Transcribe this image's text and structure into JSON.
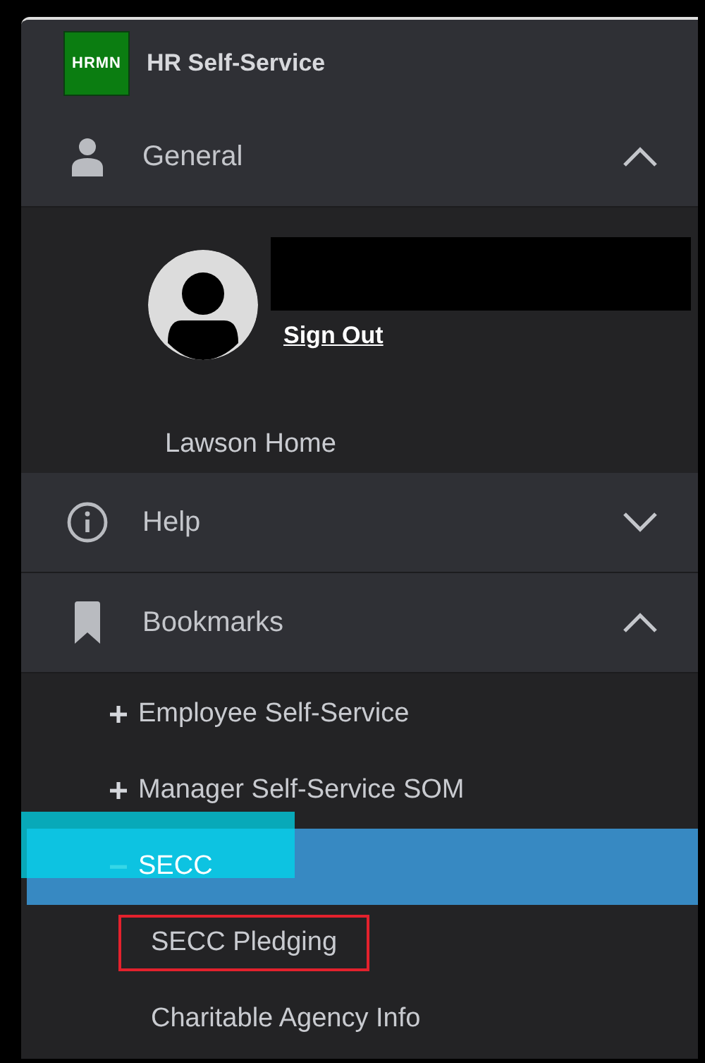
{
  "app": {
    "logo": "HRMN",
    "title": "HR Self-Service"
  },
  "sections": [
    {
      "kind": "general",
      "label": "General",
      "expanded": true,
      "user": {
        "name_redacted": true,
        "sign_out": "Sign Out"
      },
      "links": [
        "Lawson Home"
      ]
    },
    {
      "kind": "plain",
      "label": "Help",
      "expanded": false
    },
    {
      "kind": "bookmarks",
      "label": "Bookmarks",
      "expanded": true,
      "items": [
        {
          "kind": "folder",
          "label": "Employee Self-Service",
          "expanded": false,
          "selected": false,
          "highlighted": false,
          "outlined": false
        },
        {
          "kind": "folder",
          "label": "Manager Self-Service SOM",
          "expanded": false,
          "selected": false,
          "highlighted": false,
          "outlined": false
        },
        {
          "kind": "folder",
          "label": "SECC",
          "expanded": true,
          "selected": true,
          "highlighted": true,
          "outlined": false
        },
        {
          "kind": "link",
          "label": "SECC Pledging",
          "selected": false,
          "highlighted": false,
          "outlined": true
        },
        {
          "kind": "link",
          "label": "Charitable Agency Info",
          "selected": false,
          "highlighted": false,
          "outlined": false
        }
      ]
    }
  ]
}
